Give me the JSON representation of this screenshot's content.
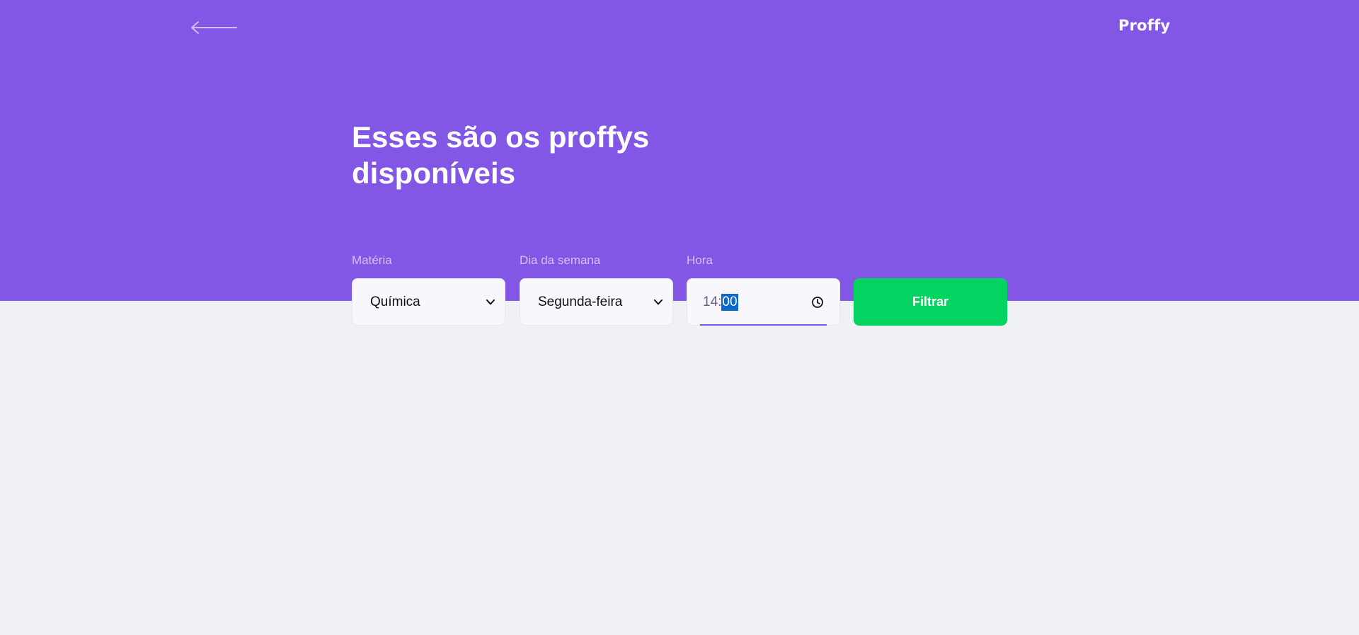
{
  "app": {
    "logo": "Proffy"
  },
  "header": {
    "title_line1": "Esses são os proffys",
    "title_line2": "disponíveis",
    "background_color": "#8257E5"
  },
  "icons": {
    "back": "arrow-left-icon",
    "select_caret": "chevron-down-icon",
    "time": "clock-icon"
  },
  "filters": {
    "subject": {
      "label": "Matéria",
      "value": "Química"
    },
    "week_day": {
      "label": "Dia da semana",
      "value": "Segunda-feira"
    },
    "time": {
      "label": "Hora",
      "hours": "14",
      "separator": ":",
      "minutes": "00"
    },
    "submit_label": "Filtrar",
    "submit_color": "#04D361"
  },
  "colors": {
    "page_background": "#F0F0F7",
    "label_text": "#D4C2FF",
    "field_background": "#F8F8FC",
    "selection_highlight": "#0A6ACB"
  }
}
